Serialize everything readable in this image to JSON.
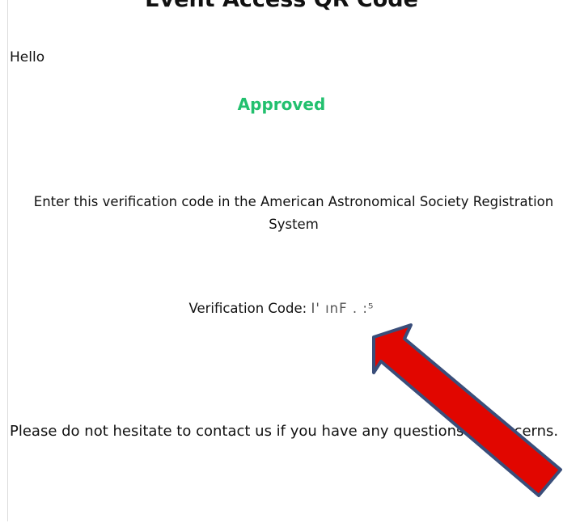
{
  "email": {
    "title": "Event Access QR Code",
    "greeting": "Hello",
    "status": "Approved",
    "status_color": "#22c06e",
    "instruction": "Enter this verification code in the American Astronomical Society Registration System",
    "code_label": "Verification Code:",
    "code_value": "I'  ınF . :⁵",
    "contact_message": "Please do not hesitate to contact us if you have any questions or concerns."
  },
  "annotation": {
    "arrow_color": "#e10600",
    "arrow_outline": "#3a4e7a"
  }
}
